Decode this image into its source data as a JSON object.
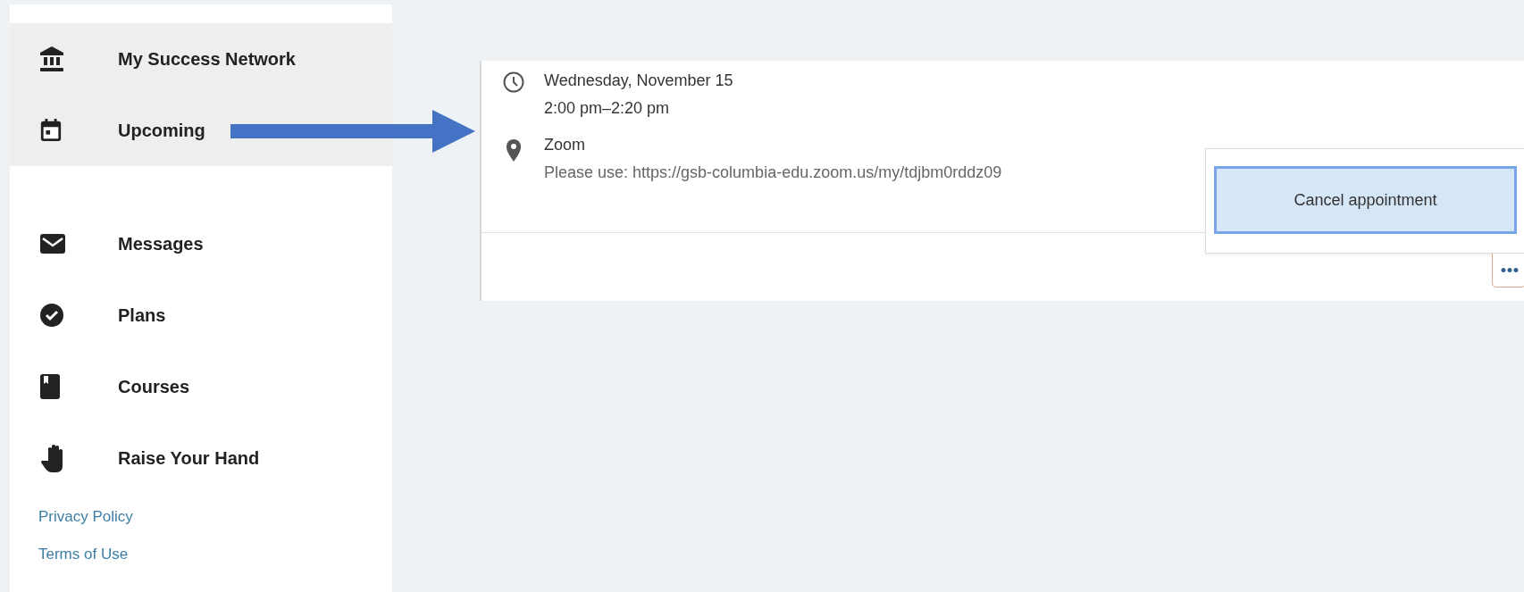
{
  "sidebar": {
    "items": [
      {
        "label": "My Success Network",
        "highlighted": true
      },
      {
        "label": "Upcoming",
        "highlighted": true
      },
      {
        "label": "Messages",
        "highlighted": false
      },
      {
        "label": "Plans",
        "highlighted": false
      },
      {
        "label": "Courses",
        "highlighted": false
      },
      {
        "label": "Raise Your Hand",
        "highlighted": false
      }
    ],
    "links": [
      "Privacy Policy",
      "Terms of Use"
    ]
  },
  "appointment": {
    "date": "Wednesday, November 15",
    "time": "2:00 pm–2:20 pm",
    "location": "Zoom",
    "location_note": "Please use: https://gsb-columbia-edu.zoom.us/my/tdjbm0rddz09",
    "menu": {
      "items": [
        {
          "label": "Cancel appointment",
          "selected": true
        }
      ]
    },
    "more_button": "•••"
  }
}
